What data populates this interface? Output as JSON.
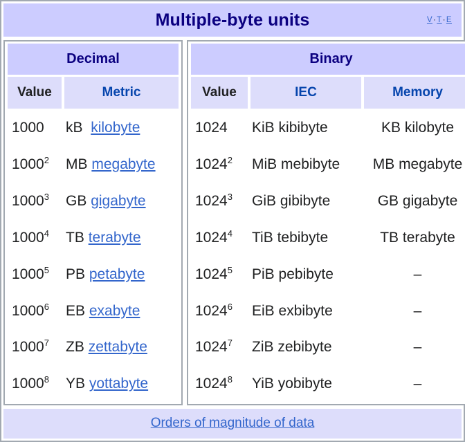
{
  "navbox": {
    "title": "Multiple-byte units",
    "vte": {
      "v": "V",
      "t": "T",
      "e": "E",
      "sep": "·"
    },
    "footer_link": "Orders of magnitude of data",
    "colors": {
      "title_bg": "#ccccff",
      "colheader_bg": "#ddddfb",
      "title_text": "#0b0080",
      "link": "#3366cc",
      "header_link": "#0645ad",
      "border": "#a2a9b1",
      "text": "#202122"
    }
  },
  "decimal": {
    "section_label": "Decimal",
    "columns": [
      {
        "label": "Value",
        "style": "plain"
      },
      {
        "label": "Metric",
        "style": "link"
      }
    ],
    "rows": [
      {
        "base": "1000",
        "exp": "",
        "symbol": "kB",
        "name": "kilobyte"
      },
      {
        "base": "1000",
        "exp": "2",
        "symbol": "MB",
        "name": "megabyte"
      },
      {
        "base": "1000",
        "exp": "3",
        "symbol": "GB",
        "name": "gigabyte"
      },
      {
        "base": "1000",
        "exp": "4",
        "symbol": "TB",
        "name": "terabyte"
      },
      {
        "base": "1000",
        "exp": "5",
        "symbol": "PB",
        "name": "petabyte"
      },
      {
        "base": "1000",
        "exp": "6",
        "symbol": "EB",
        "name": "exabyte"
      },
      {
        "base": "1000",
        "exp": "7",
        "symbol": "ZB",
        "name": "zettabyte"
      },
      {
        "base": "1000",
        "exp": "8",
        "symbol": "YB",
        "name": "yottabyte"
      }
    ]
  },
  "binary": {
    "section_label": "Binary",
    "columns": [
      {
        "label": "Value",
        "style": "plain"
      },
      {
        "label": "IEC",
        "style": "link"
      },
      {
        "label": "Memory",
        "style": "link"
      }
    ],
    "rows": [
      {
        "base": "1024",
        "exp": "",
        "iec_symbol": "KiB",
        "iec_name": "kibibyte",
        "mem_symbol": "KB",
        "mem_name": "kilobyte"
      },
      {
        "base": "1024",
        "exp": "2",
        "iec_symbol": "MiB",
        "iec_name": "mebibyte",
        "mem_symbol": "MB",
        "mem_name": "megabyte"
      },
      {
        "base": "1024",
        "exp": "3",
        "iec_symbol": "GiB",
        "iec_name": "gibibyte",
        "mem_symbol": "GB",
        "mem_name": "gigabyte"
      },
      {
        "base": "1024",
        "exp": "4",
        "iec_symbol": "TiB",
        "iec_name": "tebibyte",
        "mem_symbol": "TB",
        "mem_name": "terabyte"
      },
      {
        "base": "1024",
        "exp": "5",
        "iec_symbol": "PiB",
        "iec_name": "pebibyte",
        "mem_symbol": "–",
        "mem_name": ""
      },
      {
        "base": "1024",
        "exp": "6",
        "iec_symbol": "EiB",
        "iec_name": "exbibyte",
        "mem_symbol": "–",
        "mem_name": ""
      },
      {
        "base": "1024",
        "exp": "7",
        "iec_symbol": "ZiB",
        "iec_name": "zebibyte",
        "mem_symbol": "–",
        "mem_name": ""
      },
      {
        "base": "1024",
        "exp": "8",
        "iec_symbol": "YiB",
        "iec_name": "yobibyte",
        "mem_symbol": "–",
        "mem_name": ""
      }
    ]
  }
}
